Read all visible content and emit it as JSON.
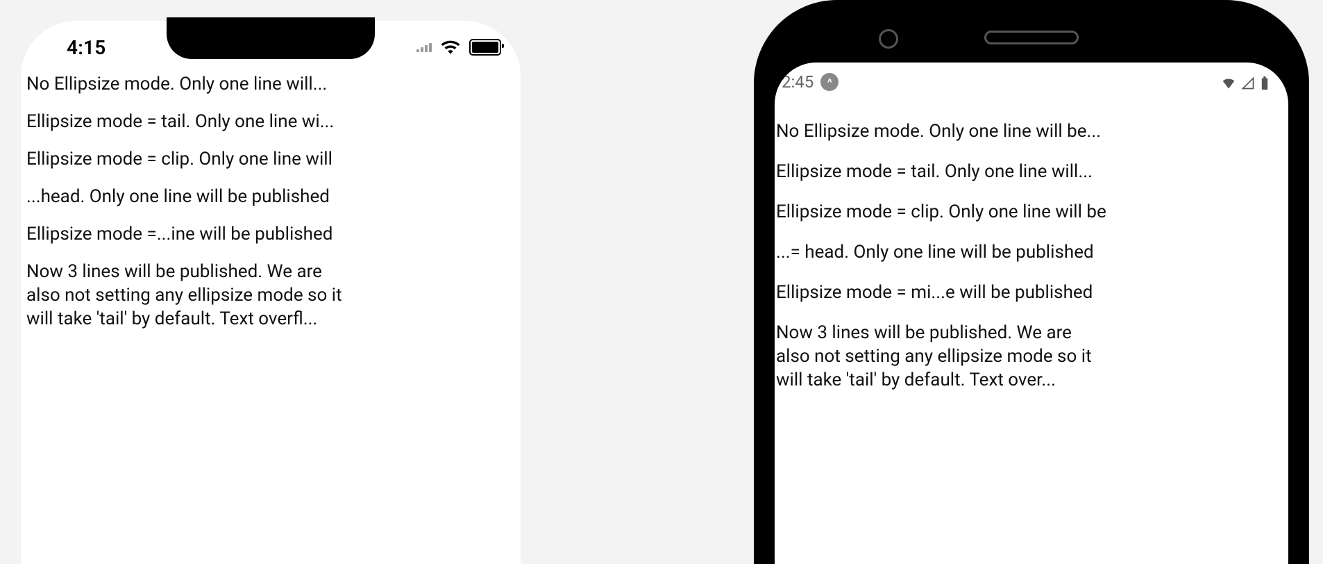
{
  "ios": {
    "status": {
      "time": "4:15"
    },
    "lines": {
      "l1": "No Ellipsize mode. Only one line will...",
      "l2": "Ellipsize mode = tail. Only one line wi...",
      "l3": "Ellipsize mode = clip. Only one line will",
      "l4": "...head. Only one line will be published",
      "l5": "Ellipsize mode =...ine will be published",
      "l6": "Now 3 lines will be published. We are also not setting any ellipsize mode so it will take 'tail' by default. Text overfl..."
    }
  },
  "android": {
    "status": {
      "time": "2:45",
      "badge": "^"
    },
    "lines": {
      "l1": "No Ellipsize mode. Only one line will be...",
      "l2": "Ellipsize mode = tail. Only one line will...",
      "l3": "Ellipsize mode = clip. Only one line will be",
      "l4": "...= head. Only one line will be published",
      "l5": "Ellipsize mode = mi...e will be published",
      "l6": "Now 3 lines will be published. We are also not setting any ellipsize mode so it will take 'tail' by default. Text over..."
    }
  }
}
